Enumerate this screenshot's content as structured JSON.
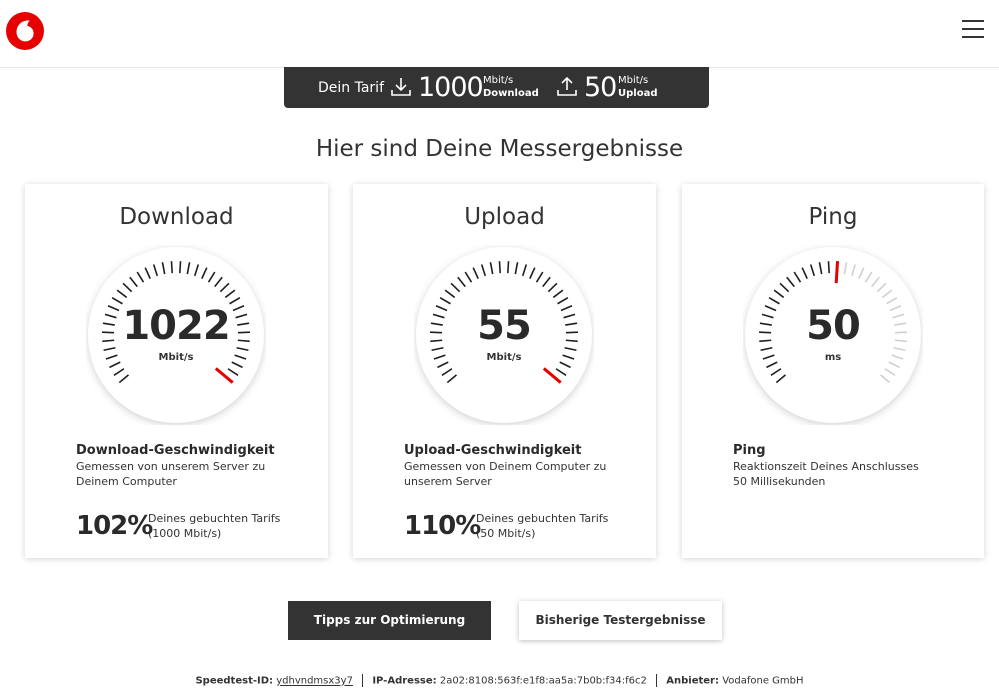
{
  "header": {
    "logo_icon": "vodafone-logo",
    "menu_icon": "hamburger-menu-icon",
    "brand_color": "#e60000"
  },
  "tariff": {
    "label": "Dein Tarif",
    "download_value": "1000",
    "download_unit": "Mbit/s",
    "download_label": "Download",
    "upload_value": "50",
    "upload_unit": "Mbit/s",
    "upload_label": "Upload",
    "download_icon": "download-icon",
    "upload_icon": "upload-icon"
  },
  "heading": "Hier sind Deine Messergebnisse",
  "cards": [
    {
      "title": "Download",
      "value": "1022",
      "unit": "Mbit/s",
      "gauge_level": 1.0,
      "desc_title": "Download-Geschwindigkeit",
      "desc_text": "Gemessen von unserem Server zu Deinem Computer",
      "percent": "102%",
      "percent_note_line1": "Deines gebuchten Tarifs",
      "percent_note_line2": "(1000 Mbit/s)"
    },
    {
      "title": "Upload",
      "value": "55",
      "unit": "Mbit/s",
      "gauge_level": 1.0,
      "desc_title": "Upload-Geschwindigkeit",
      "desc_text": "Gemessen von Deinem Computer zu unserem Server",
      "percent": "110%",
      "percent_note_line1": "Deines gebuchten Tarifs",
      "percent_note_line2": "(50 Mbit/s)"
    },
    {
      "title": "Ping",
      "value": "50",
      "unit": "ms",
      "gauge_level": 0.5,
      "desc_title": "Ping",
      "desc_text_line1": "Reaktionszeit Deines Anschlusses",
      "desc_text_line2": "50 Millisekunden"
    }
  ],
  "buttons": {
    "tips": "Tipps zur Optimierung",
    "history": "Bisherige Testergebnisse"
  },
  "footer": {
    "speedtest_id_label": "Speedtest-ID:",
    "speedtest_id": "ydhvndmsx3y7",
    "ip_label": "IP-Adresse:",
    "ip": "2a02:8108:563f:e1f8:aa5a:7b0b:f34:f6c2",
    "provider_label": "Anbieter:",
    "provider": "Vodafone GmbH"
  },
  "colors": {
    "accent": "#e60000",
    "dark": "#333333",
    "tick": "#1f1f1f",
    "tick_light": "#d0d0d0"
  }
}
